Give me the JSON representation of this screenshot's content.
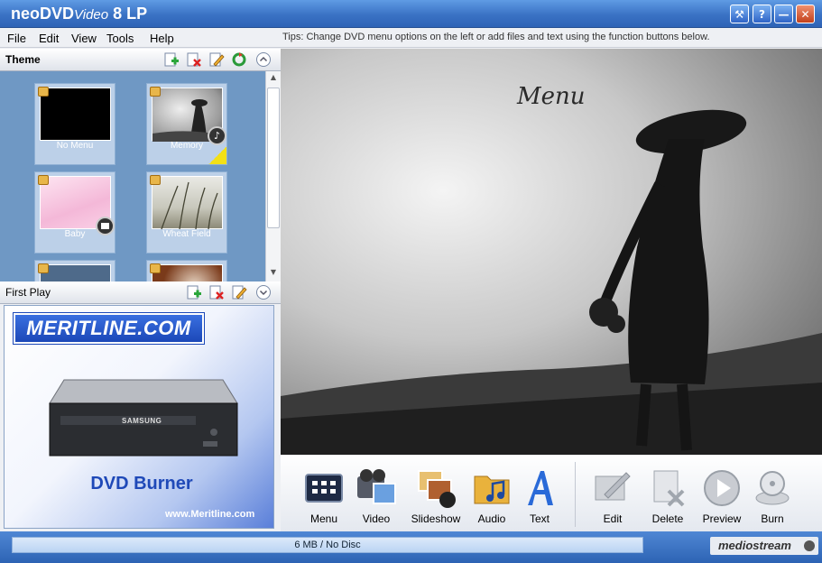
{
  "window": {
    "title_brand": "neoDVD",
    "title_video": "Video",
    "title_version": "8",
    "title_suffix": "LP",
    "controls": {
      "tools": "⚒",
      "help": "?",
      "minimize": "—",
      "close": "✕"
    }
  },
  "menu": {
    "items": [
      "File",
      "Edit",
      "View",
      "Tools",
      "Help"
    ],
    "tips": "Tips: Change DVD menu options on the left or add files and text using the function buttons below."
  },
  "theme_panel": {
    "title": "Theme",
    "tiles": [
      {
        "label": "No Menu",
        "locked": true,
        "badge": ""
      },
      {
        "label": "Memory",
        "locked": true,
        "badge": "music",
        "selected": true
      },
      {
        "label": "Baby",
        "locked": true,
        "badge": "film"
      },
      {
        "label": "Wheat Field",
        "locked": true,
        "badge": ""
      }
    ]
  },
  "first_play_panel": {
    "title": "First Play",
    "ad": {
      "logo": "MERITLINE.COM",
      "drive_brand": "SAMSUNG",
      "product": "DVD Burner",
      "url": "www.Meritline.com"
    }
  },
  "preview": {
    "menu_text": "Menu"
  },
  "toolbar": {
    "create": [
      "Menu",
      "Video",
      "Slideshow",
      "Audio",
      "Text"
    ],
    "actions": [
      "Edit",
      "Delete",
      "Preview",
      "Burn"
    ]
  },
  "status": {
    "disc": "6 MB / No Disc",
    "brand": "mediostream"
  },
  "colors": {
    "title_bar": "#3a72c4",
    "theme_grid": "#6f98c4",
    "tile_bg": "#bcd0e8",
    "ad_blue": "#1f49b8"
  }
}
